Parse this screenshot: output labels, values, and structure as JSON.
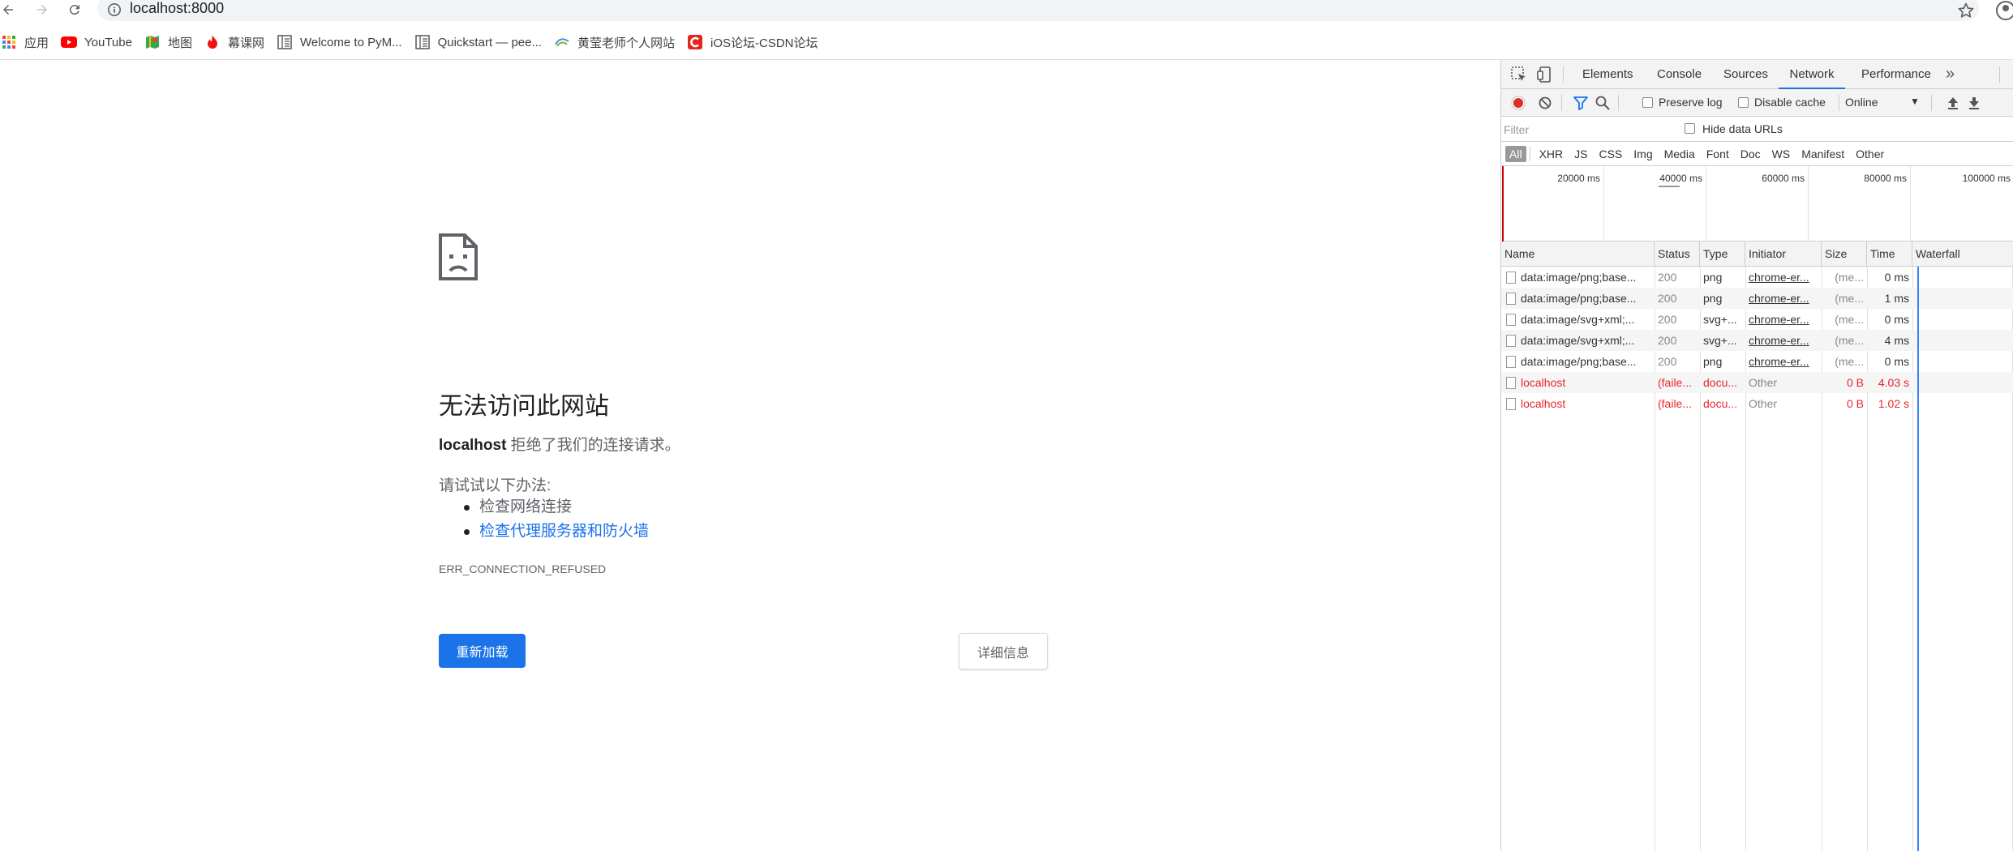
{
  "browser": {
    "url": "localhost:8000",
    "bookmarks": [
      {
        "label": "应用",
        "icon": "apps-grid-icon"
      },
      {
        "label": "YouTube",
        "icon": "youtube-icon"
      },
      {
        "label": "地图",
        "icon": "maps-icon"
      },
      {
        "label": "幕课网",
        "icon": "flame-icon"
      },
      {
        "label": "Welcome to PyM...",
        "icon": "doc-icon"
      },
      {
        "label": "Quickstart — pee...",
        "icon": "doc-icon"
      },
      {
        "label": "黄莹老师个人网站",
        "icon": "logo-icon"
      },
      {
        "label": "iOS论坛-CSDN论坛",
        "icon": "csdn-icon"
      }
    ]
  },
  "error_page": {
    "title": "无法访问此网站",
    "host": "localhost",
    "desc_rest": " 拒绝了我们的连接请求。",
    "try_label": "请试试以下办法:",
    "suggestions": [
      "检查网络连接",
      "检查代理服务器和防火墙"
    ],
    "error_code": "ERR_CONNECTION_REFUSED",
    "reload_label": "重新加载",
    "details_label": "详细信息"
  },
  "devtools": {
    "tabs": [
      "Elements",
      "Console",
      "Sources",
      "Network",
      "Performance"
    ],
    "active_tab": "Network",
    "more": "»",
    "toolbar": {
      "preserve_log": "Preserve log",
      "disable_cache": "Disable cache",
      "throttle": "Online"
    },
    "filter_placeholder": "Filter",
    "hide_data_urls": "Hide data URLs",
    "types": [
      "All",
      "XHR",
      "JS",
      "CSS",
      "Img",
      "Media",
      "Font",
      "Doc",
      "WS",
      "Manifest",
      "Other"
    ],
    "overview_ticks": [
      "20000 ms",
      "40000 ms",
      "60000 ms",
      "80000 ms",
      "100000 ms"
    ],
    "columns": [
      "Name",
      "Status",
      "Type",
      "Initiator",
      "Size",
      "Time",
      "Waterfall"
    ],
    "rows": [
      {
        "name": "data:image/png;base...",
        "status": "200",
        "type": "png",
        "initiator": "chrome-er...",
        "size": "(me...",
        "time": "0 ms",
        "failed": false
      },
      {
        "name": "data:image/png;base...",
        "status": "200",
        "type": "png",
        "initiator": "chrome-er...",
        "size": "(me...",
        "time": "1 ms",
        "failed": false
      },
      {
        "name": "data:image/svg+xml;...",
        "status": "200",
        "type": "svg+...",
        "initiator": "chrome-er...",
        "size": "(me...",
        "time": "0 ms",
        "failed": false
      },
      {
        "name": "data:image/svg+xml;...",
        "status": "200",
        "type": "svg+...",
        "initiator": "chrome-er...",
        "size": "(me...",
        "time": "4 ms",
        "failed": false
      },
      {
        "name": "data:image/png;base...",
        "status": "200",
        "type": "png",
        "initiator": "chrome-er...",
        "size": "(me...",
        "time": "0 ms",
        "failed": false
      },
      {
        "name": "localhost",
        "status": "(faile...",
        "type": "docu...",
        "initiator": "Other",
        "size": "0 B",
        "time": "4.03 s",
        "failed": true
      },
      {
        "name": "localhost",
        "status": "(faile...",
        "type": "docu...",
        "initiator": "Other",
        "size": "0 B",
        "time": "1.02 s",
        "failed": true
      }
    ]
  }
}
